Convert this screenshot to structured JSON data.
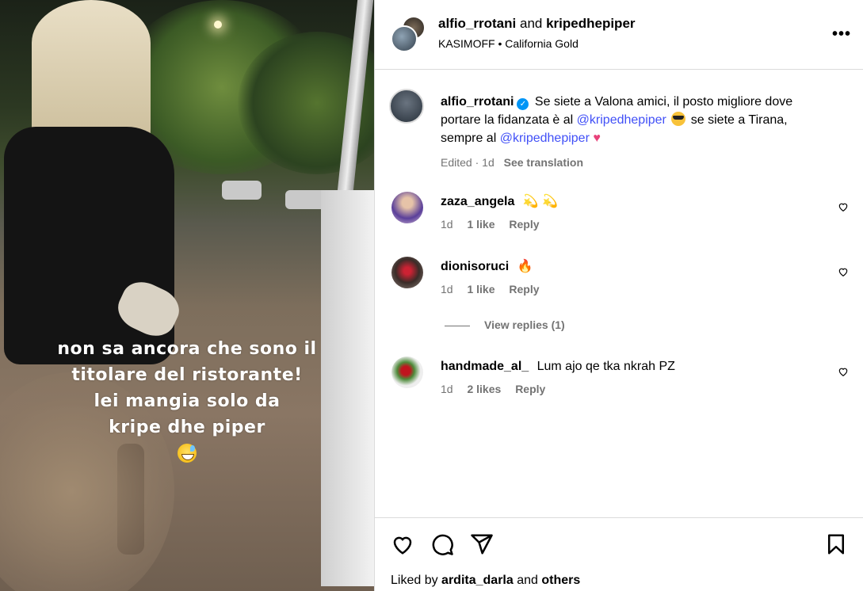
{
  "post": {
    "overlay_lines": [
      "non sa ancora che sono il",
      "titolare del ristorante!",
      "lei mangia solo da",
      "kripe dhe piper"
    ],
    "overlay_emoji": "sweat-smile-emoji"
  },
  "header": {
    "user1": "alfio_rrotani",
    "and": "and",
    "user2": "kripedhepiper",
    "music_artist": "KASIMOFF",
    "music_sep": "•",
    "music_title": "California Gold",
    "more": "•••"
  },
  "caption": {
    "username": "alfio_rrotani",
    "text1": "Se siete a Valona amici, il posto migliore dove portare la fidanzata è al",
    "mention1": "@kripedhepiper",
    "text2": "se siete a Tirana, sempre al",
    "mention2": "@kripedhepiper",
    "edited": "Edited",
    "dot": "·",
    "time": "1d",
    "see_translation": "See translation"
  },
  "comments": [
    {
      "username": "zaza_angela",
      "text": "💫 💫",
      "time": "1d",
      "likes": "1 like",
      "reply": "Reply"
    },
    {
      "username": "dionisoruci",
      "text": "🔥",
      "time": "1d",
      "likes": "1 like",
      "reply": "Reply"
    },
    {
      "username": "handmade_al_",
      "text": "Lum ajo qe tka nkrah PZ",
      "time": "1d",
      "likes": "2 likes",
      "reply": "Reply"
    }
  ],
  "view_replies": "View replies (1)",
  "liked": {
    "prefix": "Liked by",
    "user": "ardita_darla",
    "and": "and",
    "others": "others"
  },
  "colors": {
    "mention": "#4150f7",
    "verified": "#0095f6",
    "muted": "#737373"
  }
}
